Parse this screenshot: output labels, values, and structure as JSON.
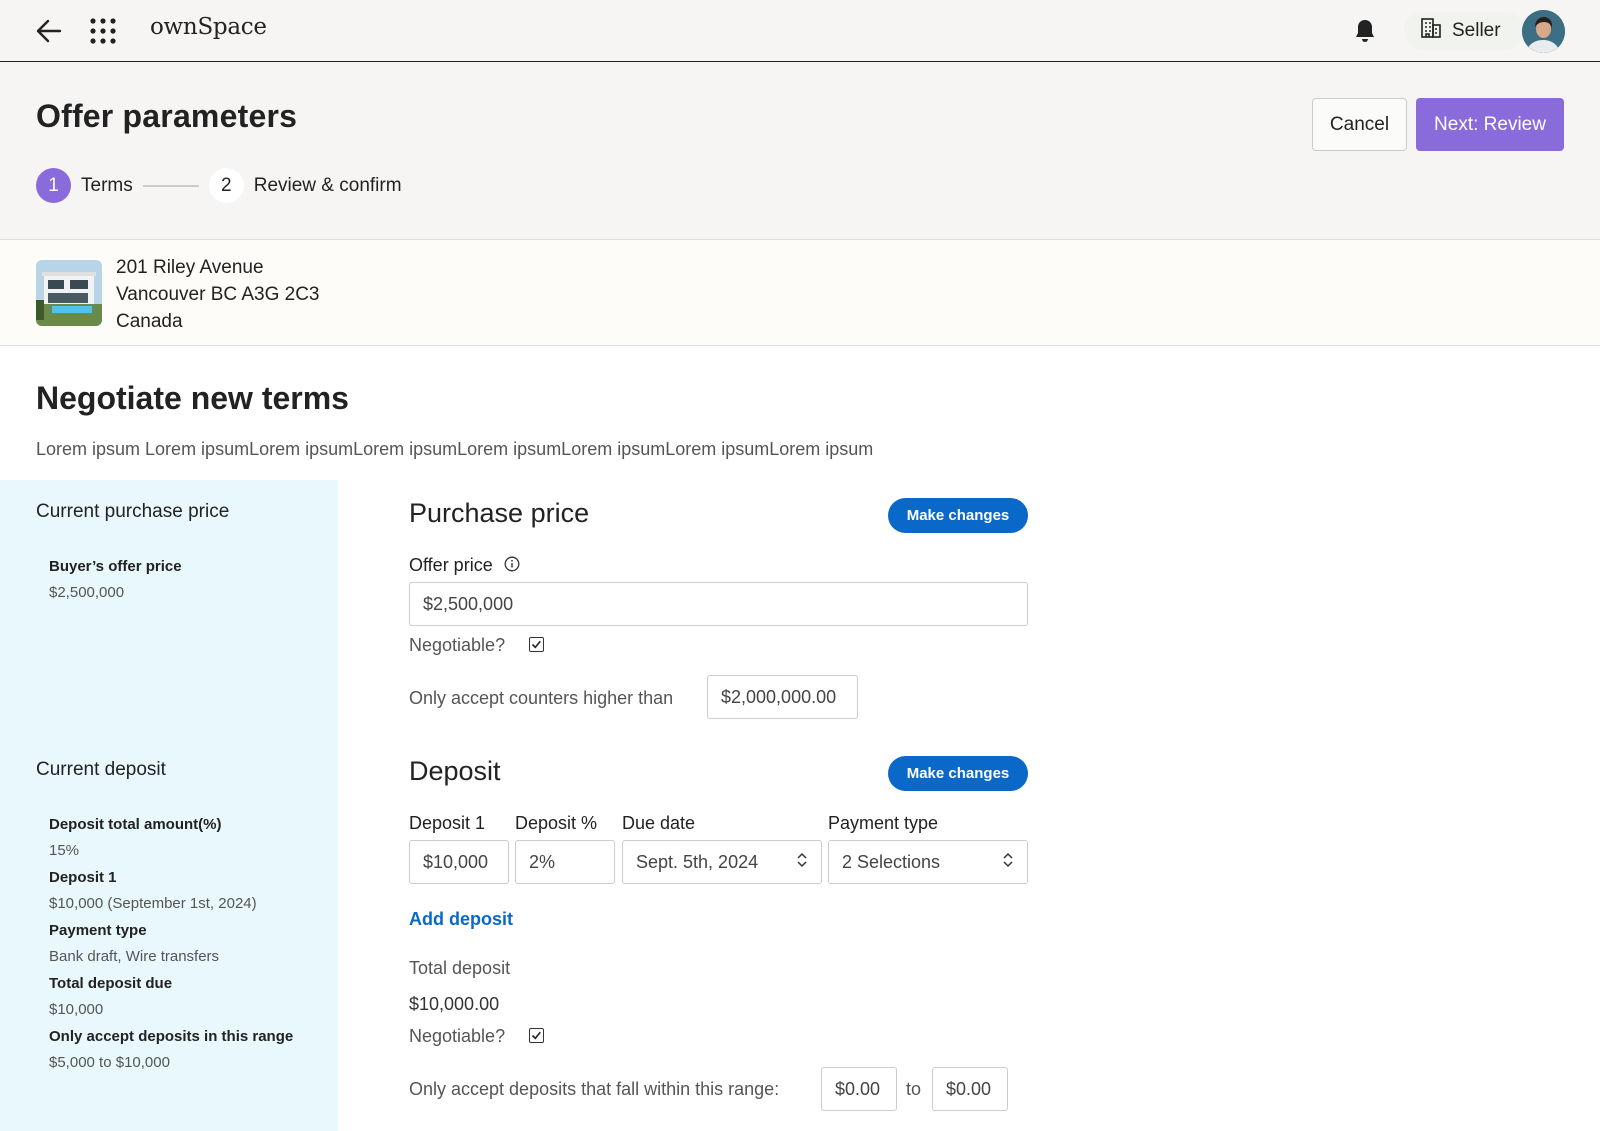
{
  "app": {
    "brand": "ownSpace",
    "role_label": "Seller"
  },
  "header": {
    "title": "Offer parameters",
    "cancel_label": "Cancel",
    "next_label": "Next: Review",
    "steps": [
      {
        "num": "1",
        "label": "Terms"
      },
      {
        "num": "2",
        "label": "Review & confirm"
      }
    ]
  },
  "address": {
    "line1": "201 Riley Avenue",
    "line2": "Vancouver BC A3G 2C3",
    "line3": "Canada"
  },
  "section": {
    "title": "Negotiate new terms",
    "description": "Lorem ipsum Lorem ipsumLorem ipsumLorem ipsumLorem ipsumLorem ipsumLorem ipsumLorem ipsum"
  },
  "sidebar": {
    "purchase": {
      "heading": "Current purchase price",
      "items": [
        {
          "label": "Buyer’s offer price",
          "value": "$2,500,000"
        }
      ]
    },
    "deposit": {
      "heading": "Current deposit",
      "items": [
        {
          "label": "Deposit total amount(%)",
          "value": "15%"
        },
        {
          "label": "Deposit 1",
          "value": "$10,000 (September 1st, 2024)"
        },
        {
          "label": "Payment type",
          "value": "Bank draft, Wire transfers"
        },
        {
          "label": "Total deposit due",
          "value": "$10,000"
        },
        {
          "label": "Only accept deposits in this range",
          "value": "$5,000 to $10,000"
        }
      ]
    }
  },
  "purchase_price": {
    "title": "Purchase price",
    "make_changes": "Make changes",
    "offer_label": "Offer price",
    "offer_value": "$2,500,000",
    "negotiable_label": "Negotiable?",
    "negotiable": true,
    "counter_label": "Only accept counters higher than",
    "counter_value": "$2,000,000.00"
  },
  "deposit": {
    "title": "Deposit",
    "make_changes": "Make changes",
    "deposit1_label": "Deposit 1",
    "deposit1_value": "$10,000",
    "percent_label": "Deposit %",
    "percent_value": "2%",
    "due_label": "Due date",
    "due_value": "Sept. 5th, 2024",
    "payment_label": "Payment type",
    "payment_value": "2 Selections",
    "add_deposit": "Add deposit",
    "total_label": "Total deposit",
    "total_value": "$10,000.00",
    "negotiable_label": "Negotiable?",
    "negotiable": true,
    "range_label": "Only accept deposits that fall within this range:",
    "range_min": "$0.00",
    "range_to": "to",
    "range_max": "$0.00"
  },
  "colors": {
    "accent": "#8a6bdc",
    "primary_button": "#0a69c8",
    "sidebar_bg": "#e8f8fc"
  }
}
